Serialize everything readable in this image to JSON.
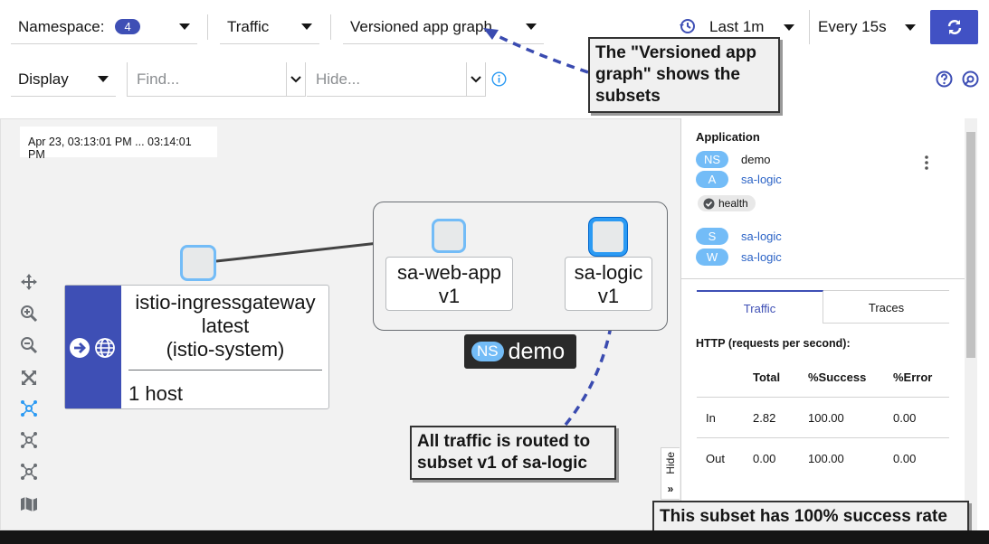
{
  "toolbar": {
    "namespace_label": "Namespace:",
    "namespace_count": "4",
    "traffic_label": "Traffic",
    "graph_type_label": "Versioned app graph",
    "duration_label": "Last 1m",
    "refresh_interval_label": "Every 15s"
  },
  "toolbar2": {
    "display_label": "Display",
    "find_placeholder": "Find...",
    "hide_placeholder": "Hide..."
  },
  "graph": {
    "timestamp": "Apr 23, 03:13:01 PM ... 03:14:01 PM",
    "ingress_node": {
      "name": "istio-ingressgateway",
      "version": "latest",
      "namespace": "(istio-system)",
      "hosts": "1 host"
    },
    "webapp_node": {
      "name": "sa-web-app",
      "version": "v1"
    },
    "logic_node": {
      "name": "sa-logic",
      "version": "v1"
    },
    "namespace_badge": "NS",
    "namespace_name": "demo"
  },
  "side_panel": {
    "heading": "Application",
    "ns_badge": "NS",
    "ns_value": "demo",
    "app_badge": "A",
    "app_value": "sa-logic",
    "health_label": "health",
    "service_badge": "S",
    "service_value": "sa-logic",
    "workload_badge": "W",
    "workload_value": "sa-logic",
    "tabs": [
      "Traffic",
      "Traces"
    ],
    "http_title": "HTTP (requests per second):",
    "table_headers": [
      "",
      "Total",
      "%Success",
      "%Error"
    ],
    "rows": [
      [
        "In",
        "2.82",
        "100.00",
        "0.00"
      ],
      [
        "Out",
        "0.00",
        "100.00",
        "0.00"
      ]
    ],
    "hide_label": "Hide"
  },
  "callouts": {
    "versioned": "The \"Versioned app graph\" shows the subsets",
    "routing": "All traffic is routed to subset v1 of sa-logic",
    "success": "This subset has 100% success rate"
  },
  "colors": {
    "primary_blue": "#4151c4",
    "node_border": "#73bcf7",
    "ingress_stripe": "#3e4fb5",
    "link": "#2b63c6"
  }
}
